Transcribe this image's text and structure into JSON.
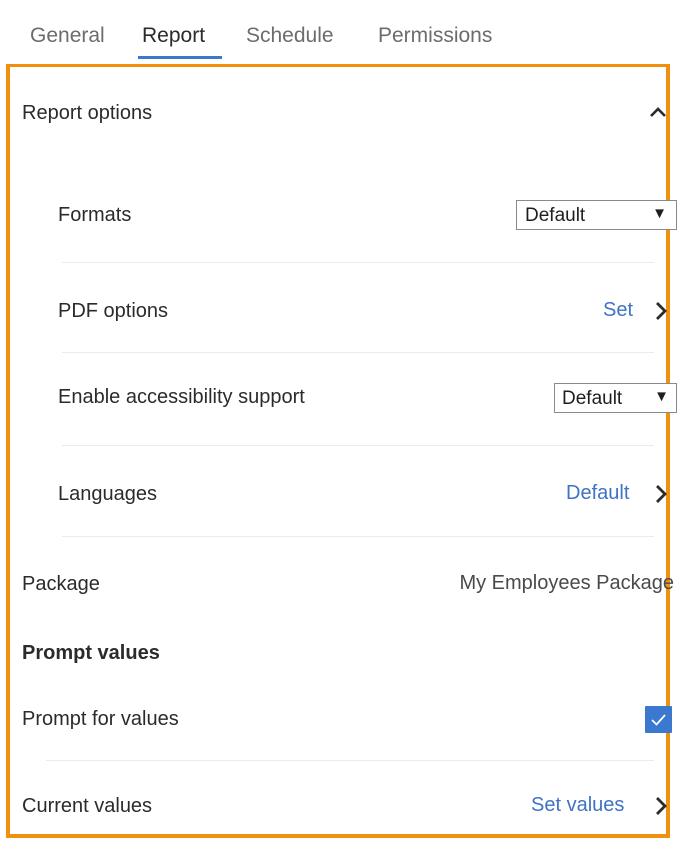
{
  "tabs": [
    {
      "label": "General",
      "active": false
    },
    {
      "label": "Report",
      "active": true
    },
    {
      "label": "Schedule",
      "active": false
    },
    {
      "label": "Permissions",
      "active": false
    }
  ],
  "report_options": {
    "title": "Report options",
    "expanded": true,
    "collapse_icon": "chevron-up-icon",
    "formats": {
      "label": "Formats",
      "value": "Default"
    },
    "pdf_options": {
      "label": "PDF options",
      "action": "Set"
    },
    "accessibility": {
      "label": "Enable accessibility support",
      "value": "Default"
    },
    "languages": {
      "label": "Languages",
      "action": "Default"
    }
  },
  "package": {
    "label": "Package",
    "value": "My Employees Package"
  },
  "prompt_values": {
    "title": "Prompt values",
    "prompt_for_values": {
      "label": "Prompt for values",
      "checked": true
    },
    "current_values": {
      "label": "Current values",
      "action": "Set values"
    }
  },
  "colors": {
    "accent": "#3b78d0",
    "link": "#3f73c4",
    "focus_border": "#f0900f"
  }
}
